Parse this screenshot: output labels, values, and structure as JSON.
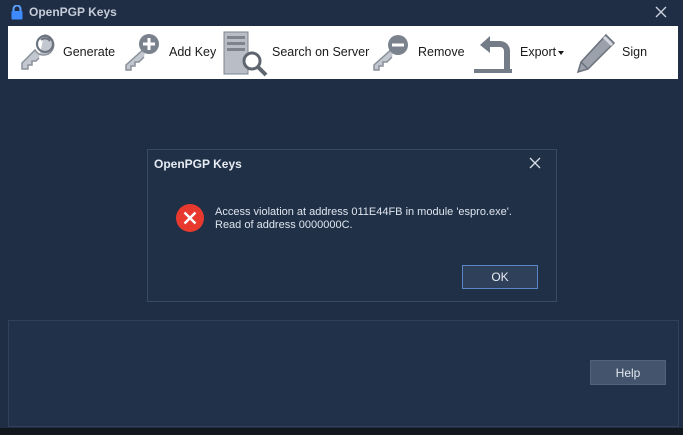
{
  "window": {
    "title": "OpenPGP Keys"
  },
  "toolbar": {
    "generate": "Generate",
    "add_key": "Add Key",
    "search_server": "Search on Server",
    "remove": "Remove",
    "export": "Export",
    "sign": "Sign"
  },
  "dialog": {
    "title": "OpenPGP Keys",
    "message_line1": "Access violation at address 011E44FB in module 'espro.exe'.",
    "message_line2": "Read of address 0000000C.",
    "ok_label": "OK"
  },
  "footer": {
    "help_label": "Help"
  },
  "colors": {
    "accent": "#5b86c8",
    "error": "#e8392f",
    "background": "#1f2d45"
  }
}
